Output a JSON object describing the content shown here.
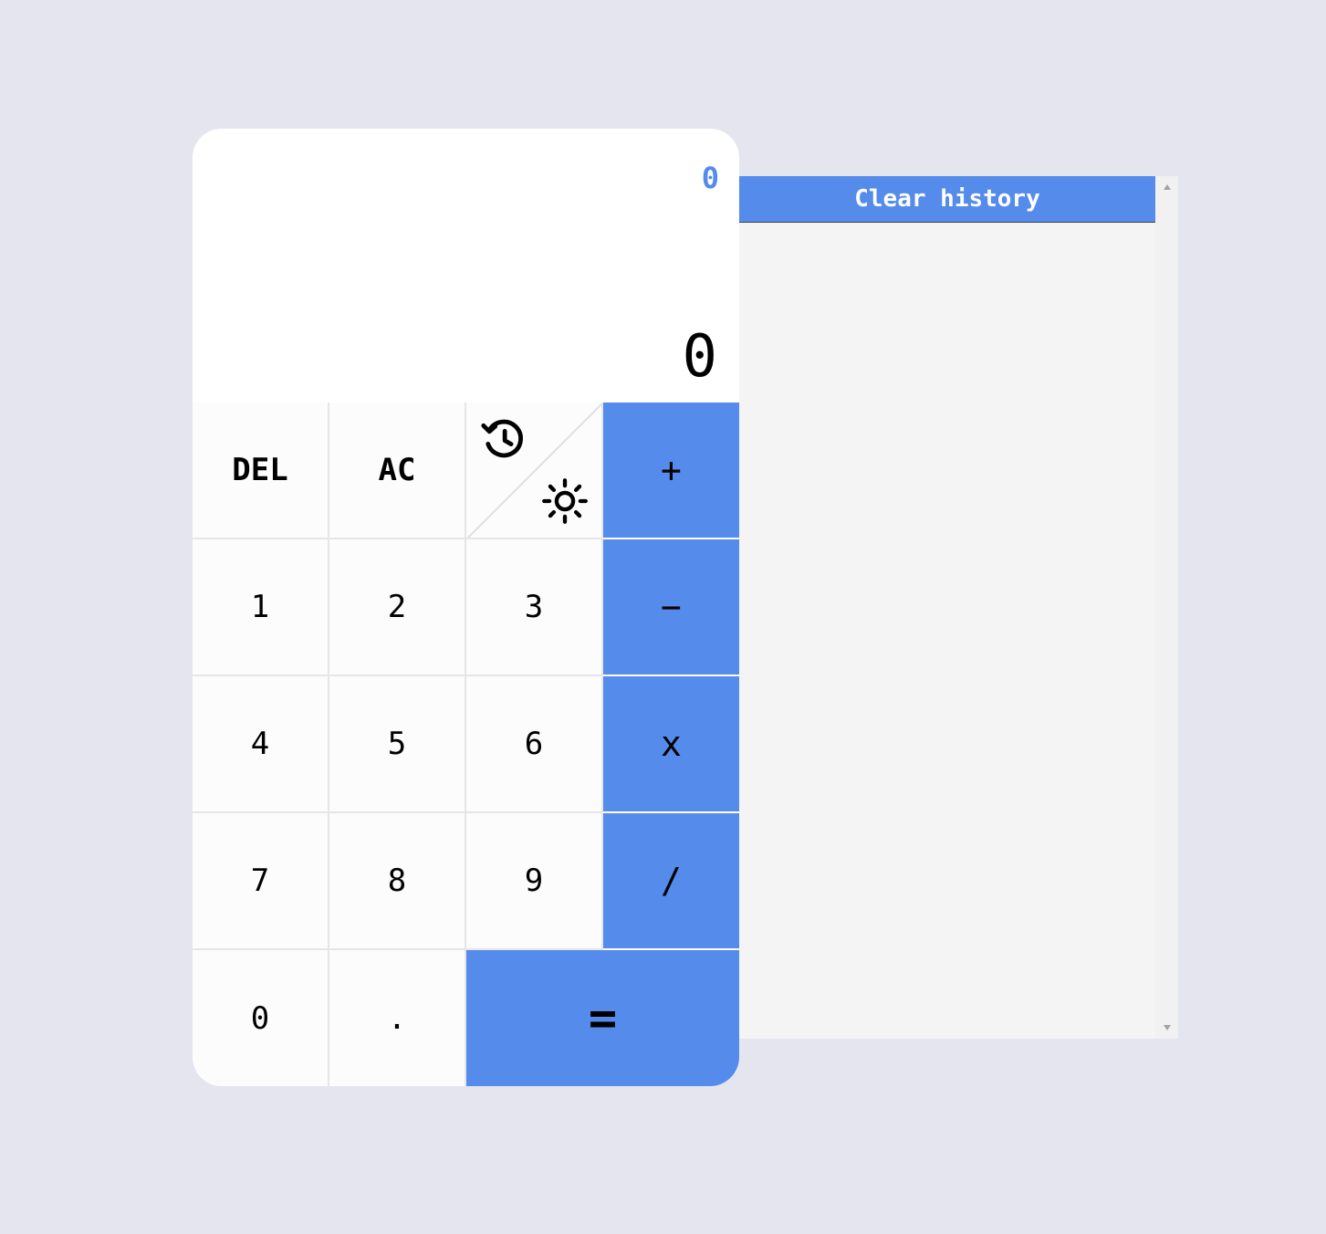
{
  "display": {
    "previous": "0",
    "current": "0"
  },
  "keys": {
    "del": "DEL",
    "ac": "AC",
    "plus": "+",
    "minus": "−",
    "multiply": "x",
    "divide": "/",
    "one": "1",
    "two": "2",
    "three": "3",
    "four": "4",
    "five": "5",
    "six": "6",
    "seven": "7",
    "eight": "8",
    "nine": "9",
    "zero": "0",
    "dot": ".",
    "equals": "="
  },
  "icons": {
    "history": "history-icon",
    "theme": "sun-icon"
  },
  "history": {
    "clear_label": "Clear history",
    "entries": []
  },
  "colors": {
    "accent": "#558beb",
    "background": "#e5e5f0",
    "panel": "#f4f4f4",
    "key": "#fcfcfc"
  }
}
